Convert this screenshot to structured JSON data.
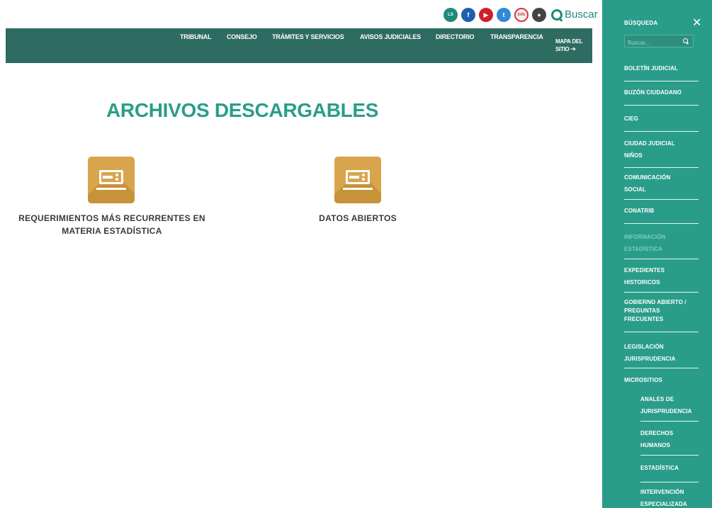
{
  "header": {
    "social_icons": [
      {
        "name": "lengua-de-senas-icon",
        "text": "LS"
      },
      {
        "name": "facebook-icon",
        "text": "f"
      },
      {
        "name": "youtube-icon",
        "text": "▶"
      },
      {
        "name": "twitter-icon",
        "text": "t"
      },
      {
        "name": "infomex-icon",
        "text": "info"
      },
      {
        "name": "radio-icon",
        "text": "●"
      }
    ],
    "search_label": "Buscar"
  },
  "nav": {
    "items": [
      "TRIBUNAL",
      "CONSEJO",
      "TRÁMITES Y SERVICIOS",
      "AVISOS JUDICIALES",
      "DIRECTORIO",
      "TRANSPARENCIA"
    ],
    "mapa_line1": "MAPA DEL",
    "mapa_line2": "SITIO"
  },
  "main": {
    "title": "ARCHIVOS DESCARGABLES",
    "cards": [
      {
        "line1": "REQUERIMIENTOS MÁS RECURRENTES EN",
        "line2": "MATERIA ESTADÍSTICA"
      },
      {
        "line1": "DATOS ABIERTOS",
        "line2": ""
      }
    ]
  },
  "sidebar": {
    "heading": "BÚSQUEDA",
    "close": "✕",
    "search_placeholder": "Buscar...",
    "items": [
      {
        "l1": "BOLETÍN JUDICIAL",
        "l2": ""
      },
      {
        "l1": "BUZÓN CIUDADANO",
        "l2": ""
      },
      {
        "l1": "CIEG",
        "l2": ""
      },
      {
        "l1": "CIUDAD JUDICIAL",
        "l2": "NIÑOS"
      },
      {
        "l1": "COMUNICACIÓN",
        "l2": "SOCIAL"
      },
      {
        "l1": "CONATRIB",
        "l2": ""
      },
      {
        "l1": "INFORMACIÓN",
        "l2": "ESTADÍSTICA"
      },
      {
        "l1": "EXPEDIENTES",
        "l2": "HISTORICOS"
      },
      {
        "l1": "GOBIERNO ABIERTO /",
        "l2": "PREGUNTAS",
        "l3": "FRECUENTES"
      },
      {
        "l1": "LEGISLACIÓN",
        "l2": "JURISPRUDENCIA"
      },
      {
        "l1": "MICROSITIOS",
        "l2": ""
      }
    ],
    "subitems": [
      {
        "l1": "ANALES DE",
        "l2": "JURISPRUDENCIA"
      },
      {
        "l1": "DERECHOS",
        "l2": "HUMANOS"
      },
      {
        "l1": "ESTADÍSTICA",
        "l2": ""
      },
      {
        "l1": "INTERVENCIÓN",
        "l2": "ESPECIALIZADA"
      }
    ]
  }
}
